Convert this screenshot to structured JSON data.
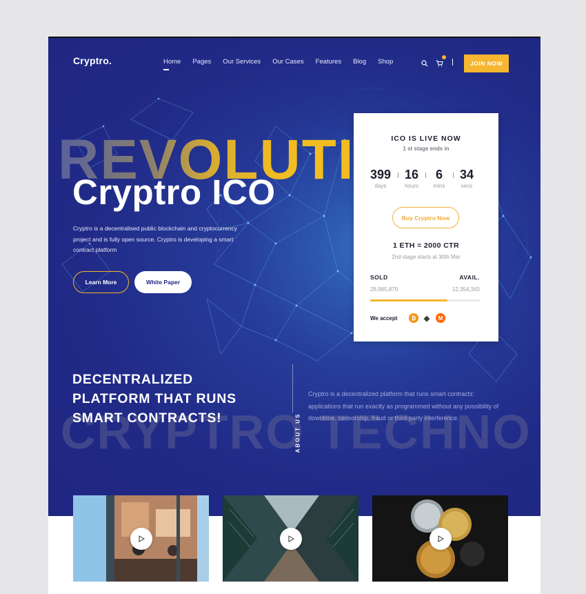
{
  "brand": {
    "logo": "Cryptro."
  },
  "nav": {
    "items": [
      "Home",
      "Pages",
      "Our Services",
      "Our Cases",
      "Features",
      "Blog",
      "Shop"
    ],
    "active_index": 0,
    "cta_label": "JOIN NOW",
    "search_icon": "search-icon",
    "cart_icon": "cart-icon"
  },
  "hero": {
    "background_word": "REVOLUTION",
    "title": "Cryptro ICO",
    "description": "Cryptro is a decentralised public blockchain and cryptocurrency project and is fully open source. Cryptro is developing a smart contract platform",
    "primary_button": "Learn More",
    "secondary_button": "White Paper"
  },
  "ico_card": {
    "title": "ICO IS LIVE NOW",
    "subtitle": "1 st stage ends in",
    "countdown": [
      {
        "value": "399",
        "label": "days"
      },
      {
        "value": "16",
        "label": "hours"
      },
      {
        "value": "6",
        "label": "mins"
      },
      {
        "value": "34",
        "label": "secs"
      }
    ],
    "buy_button": "Buy Cryptro Now",
    "rate": "1 ETH = 2000 CTR",
    "rate_note": "2nd stage starts at 30th Mar",
    "sold_label": "SOLD",
    "sold_value": "28,985,879",
    "avail_label": "AVAIL.",
    "avail_value": "12,354,343",
    "progress_fraction": 0.7,
    "accept_label": "We accept",
    "coins": [
      {
        "icon": "bitcoin-icon",
        "color": "#f7931a"
      },
      {
        "icon": "ethereum-icon",
        "color": "#3c3c3d"
      },
      {
        "icon": "monero-icon",
        "color": "#ff6600"
      }
    ]
  },
  "about": {
    "tagline": [
      "DECENTRALIZED",
      "PLATFORM THAT RUNS",
      "SMART CONTRACTS!"
    ],
    "background_word": "CRYPTRO TECHNO",
    "vertical_label": "ABOUT US",
    "text": "Cryptro is a decentralized platform that runs smart contracts: applications that run exactly as programmed without any possibility of downtime, censorship, fraud or third-party interference."
  },
  "videos": [
    {
      "name": "video-card-office",
      "play_icon": "play-icon"
    },
    {
      "name": "video-card-buildings",
      "play_icon": "play-icon"
    },
    {
      "name": "video-card-coins",
      "play_icon": "play-icon"
    }
  ],
  "colors": {
    "hero_bg": "#1f2682",
    "accent": "#f6b62f",
    "text_light": "#ffffff"
  }
}
